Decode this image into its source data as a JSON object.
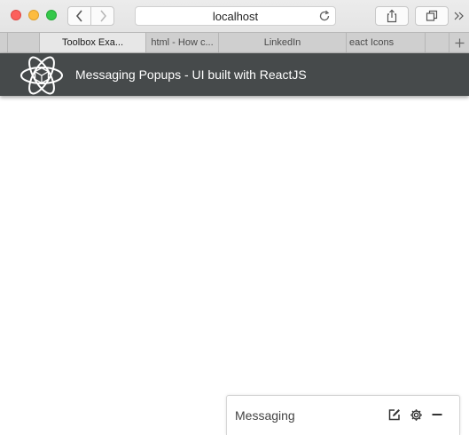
{
  "browser": {
    "address": "localhost",
    "tabs": [
      {
        "label": "Toolbox Exa...",
        "active": true
      },
      {
        "label": "html - How c...",
        "active": false
      },
      {
        "label": "LinkedIn",
        "active": false
      },
      {
        "label": "eact Icons",
        "active": false
      }
    ],
    "icons": [
      "back-icon",
      "forward-icon",
      "reload-icon",
      "share-icon",
      "tabs-overview-icon",
      "more-icon",
      "new-tab-icon"
    ]
  },
  "app": {
    "title": "Messaging Popups - UI built with ReactJS",
    "header_color": "#464a4b",
    "logo_icon": "react-atom-logo"
  },
  "messaging": {
    "title": "Messaging",
    "icons": [
      "compose-icon",
      "settings-icon",
      "minimize-icon"
    ]
  }
}
